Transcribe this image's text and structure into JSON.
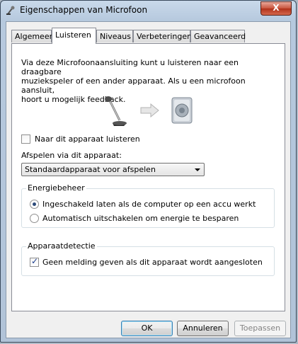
{
  "window": {
    "title": "Eigenschappen van Microfoon",
    "close_label": "X"
  },
  "tabs": [
    {
      "label": "Algemeen",
      "active": false
    },
    {
      "label": "Luisteren",
      "active": true
    },
    {
      "label": "Niveaus",
      "active": false
    },
    {
      "label": "Verbeteringen",
      "active": false
    },
    {
      "label": "Geavanceerd",
      "active": false
    }
  ],
  "panel": {
    "description_lines": [
      "Via deze Microfoonaansluiting kunt u luisteren naar een draagbare",
      "muziekspeler of een ander apparaat. Als u een microfoon aansluit,",
      "hoort u mogelijk feedback."
    ],
    "icons": [
      "microphone-icon",
      "arrow-right-icon",
      "speaker-icon"
    ],
    "listen_checkbox": {
      "label": "Naar dit apparaat luisteren",
      "checked": false
    },
    "playback_label": "Afspelen via dit apparaat:",
    "playback_select": {
      "value": "Standaardapparaat voor afspelen"
    },
    "power_group": {
      "title": "Energiebeheer",
      "options": [
        {
          "label": "Ingeschakeld laten als de computer op een accu werkt",
          "selected": true
        },
        {
          "label": "Automatisch uitschakelen om energie te besparen",
          "selected": false
        }
      ]
    },
    "detection_group": {
      "title": "Apparaatdetectie",
      "checkbox": {
        "label": "Geen melding geven als dit apparaat wordt aangesloten",
        "checked": true
      }
    }
  },
  "buttons": {
    "ok": "OK",
    "cancel": "Annuleren",
    "apply": "Toepassen"
  },
  "colors": {
    "accent": "#3c7fb1",
    "close": "#c8533c"
  }
}
